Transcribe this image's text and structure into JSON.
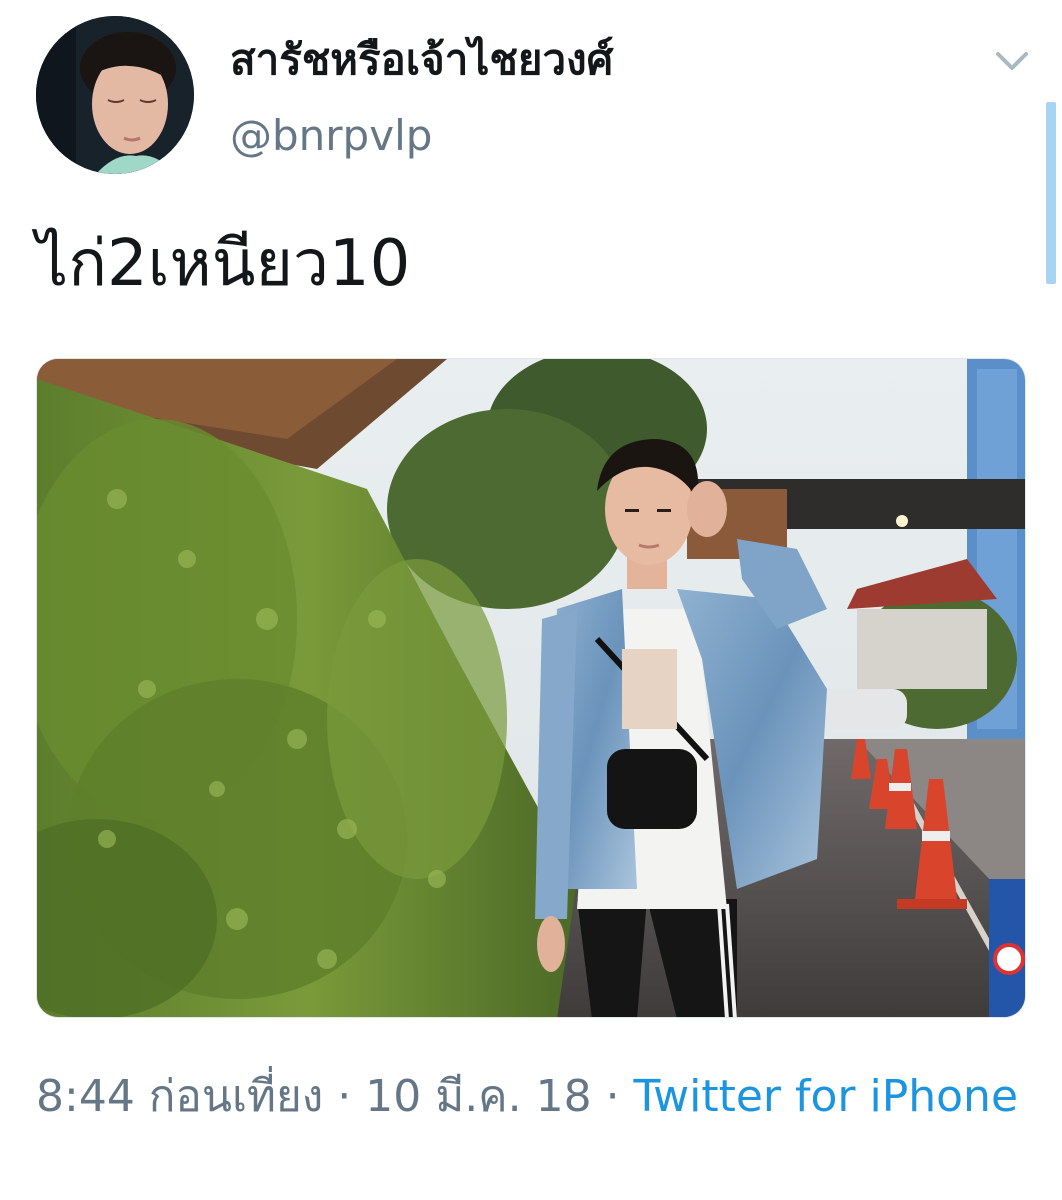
{
  "tweet": {
    "display_name": "สารัชหรือเจ้าไชยวงศ์",
    "handle": "@bnrpvlp",
    "text": "ไก่2เหนียว10",
    "time": "8:44 ก่อนเที่ยง",
    "separator": " · ",
    "date": "10 มี.ค. 18",
    "source": "Twitter for iPhone"
  },
  "icons": {
    "avatar": "profile-photo",
    "menu": "chevron-down-icon",
    "media": "attached-photo"
  },
  "colors": {
    "text_primary": "#14171a",
    "text_secondary": "#657786",
    "link": "#1b95e0",
    "scroll_indicator": "#a8d4f4"
  }
}
